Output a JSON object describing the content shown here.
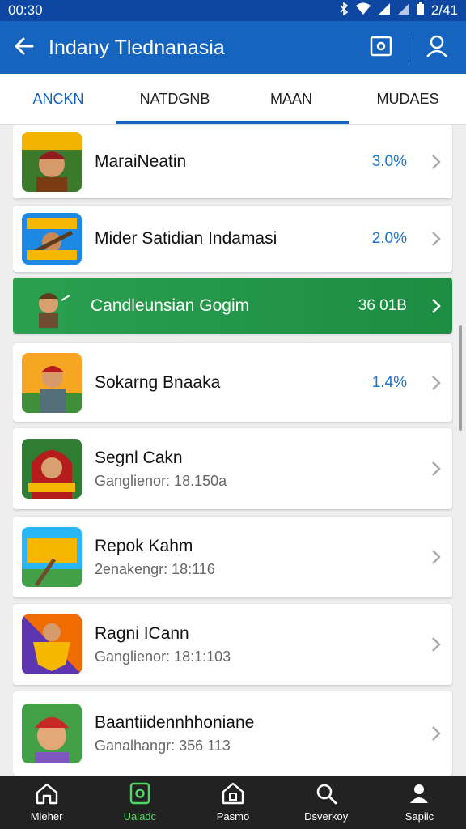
{
  "status_bar": {
    "time": "00:30",
    "right_text": "2/41"
  },
  "app_bar": {
    "title": "Indany Tlednanasia"
  },
  "tabs": [
    {
      "label": "ANCKN"
    },
    {
      "label": "NATDGNB"
    },
    {
      "label": "MAAN"
    },
    {
      "label": "MUDAES"
    }
  ],
  "items": [
    {
      "name": "MaraiNeatin",
      "value": "3.0%"
    },
    {
      "name": "Mider Satidian Indamasi",
      "value": "2.0%"
    },
    {
      "name": "Candleunsian Gogim",
      "value": "36 01B"
    },
    {
      "name": "Sokarng Bnaaka",
      "value": "1.4%"
    },
    {
      "name": "Segnl Cakn",
      "subtitle": "Ganglienor: 18.150a"
    },
    {
      "name": "Repok Kahm",
      "subtitle": "2enakengr: 18:116"
    },
    {
      "name": "Ragni ICann",
      "subtitle": "Ganglienor: 18:1:103"
    },
    {
      "name": "Baantiidennhhoniane",
      "subtitle": "Ganalhangr: 356 113"
    }
  ],
  "bottom_nav": [
    {
      "label": "Mieher",
      "icon": "home-icon"
    },
    {
      "label": "Uaiadc",
      "icon": "tablet-icon"
    },
    {
      "label": "Pasmo",
      "icon": "house-icon"
    },
    {
      "label": "Dsverkoy",
      "icon": "search-icon"
    },
    {
      "label": "Sapiic",
      "icon": "profile-icon"
    }
  ],
  "colors": {
    "primary": "#1565c0",
    "highlight": "#2aa04f",
    "accent_text": "#1976d2",
    "nav_active": "#4cd964"
  }
}
